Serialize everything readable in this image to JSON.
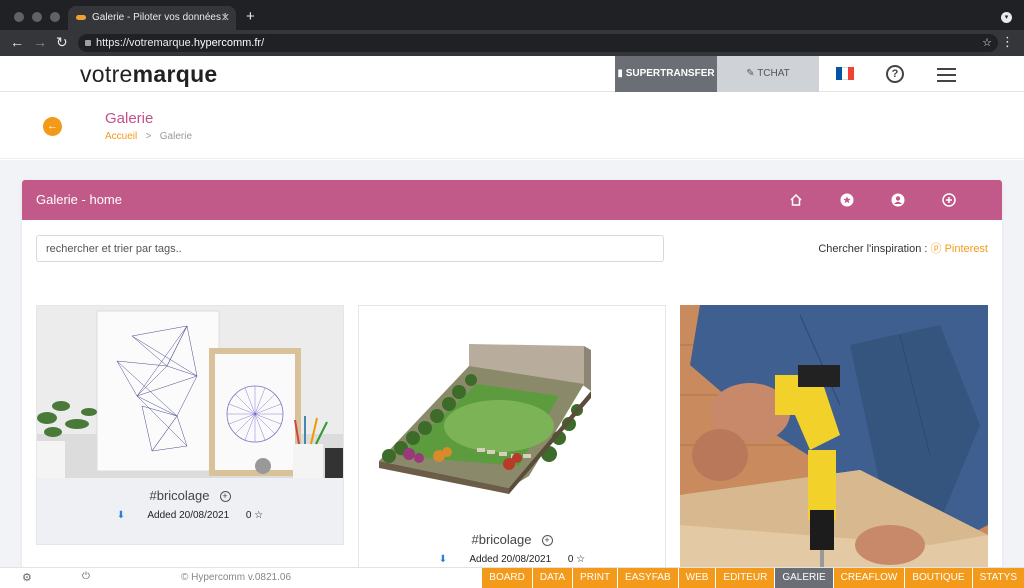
{
  "browser": {
    "tab_title": "Galerie - Piloter vos données !",
    "tab_close": "✕",
    "new_tab": "+",
    "url_prefix": "https://votremarque.",
    "url_domain": "hypercomm.fr",
    "url_suffix": "/"
  },
  "app": {
    "logo_regular": "votre",
    "logo_bold": "marque",
    "supertransfer_label": "SUPERTRANSFER",
    "tchat_label": "TCHAT",
    "flag_colors": [
      "#0055a4",
      "#ffffff",
      "#ef4135"
    ]
  },
  "page": {
    "title": "Galerie",
    "breadcrumb_home": "Accueil",
    "breadcrumb_sep": ">",
    "breadcrumb_current": "Galerie"
  },
  "panel": {
    "title": "Galerie - home",
    "icons": [
      "home-icon",
      "star-icon",
      "user-icon",
      "add-icon"
    ],
    "search_placeholder": "rechercher et trier par tags..",
    "inspiration_label": "Chercher l'inspiration : ",
    "inspiration_link": "Pinterest"
  },
  "cards": [
    {
      "tag": "#bricolage",
      "added": "Added 20/08/2021",
      "count": "0 ☆"
    },
    {
      "tag": "#bricolage",
      "added": "Added 20/08/2021",
      "count": "0 ☆"
    },
    {
      "tag": "",
      "added": "",
      "count": ""
    }
  ],
  "footer": {
    "version": "© Hypercomm v.0821.06",
    "nav": [
      "BOARD",
      "DATA",
      "PRINT",
      "EASYFAB",
      "WEB",
      "EDITEUR",
      "GALERIE",
      "CREAFLOW",
      "BOUTIQUE",
      "STATYS"
    ],
    "active": "GALERIE"
  },
  "colors": {
    "accent": "#c25a89",
    "orange": "#f39a1a",
    "chrome": "#202124"
  }
}
